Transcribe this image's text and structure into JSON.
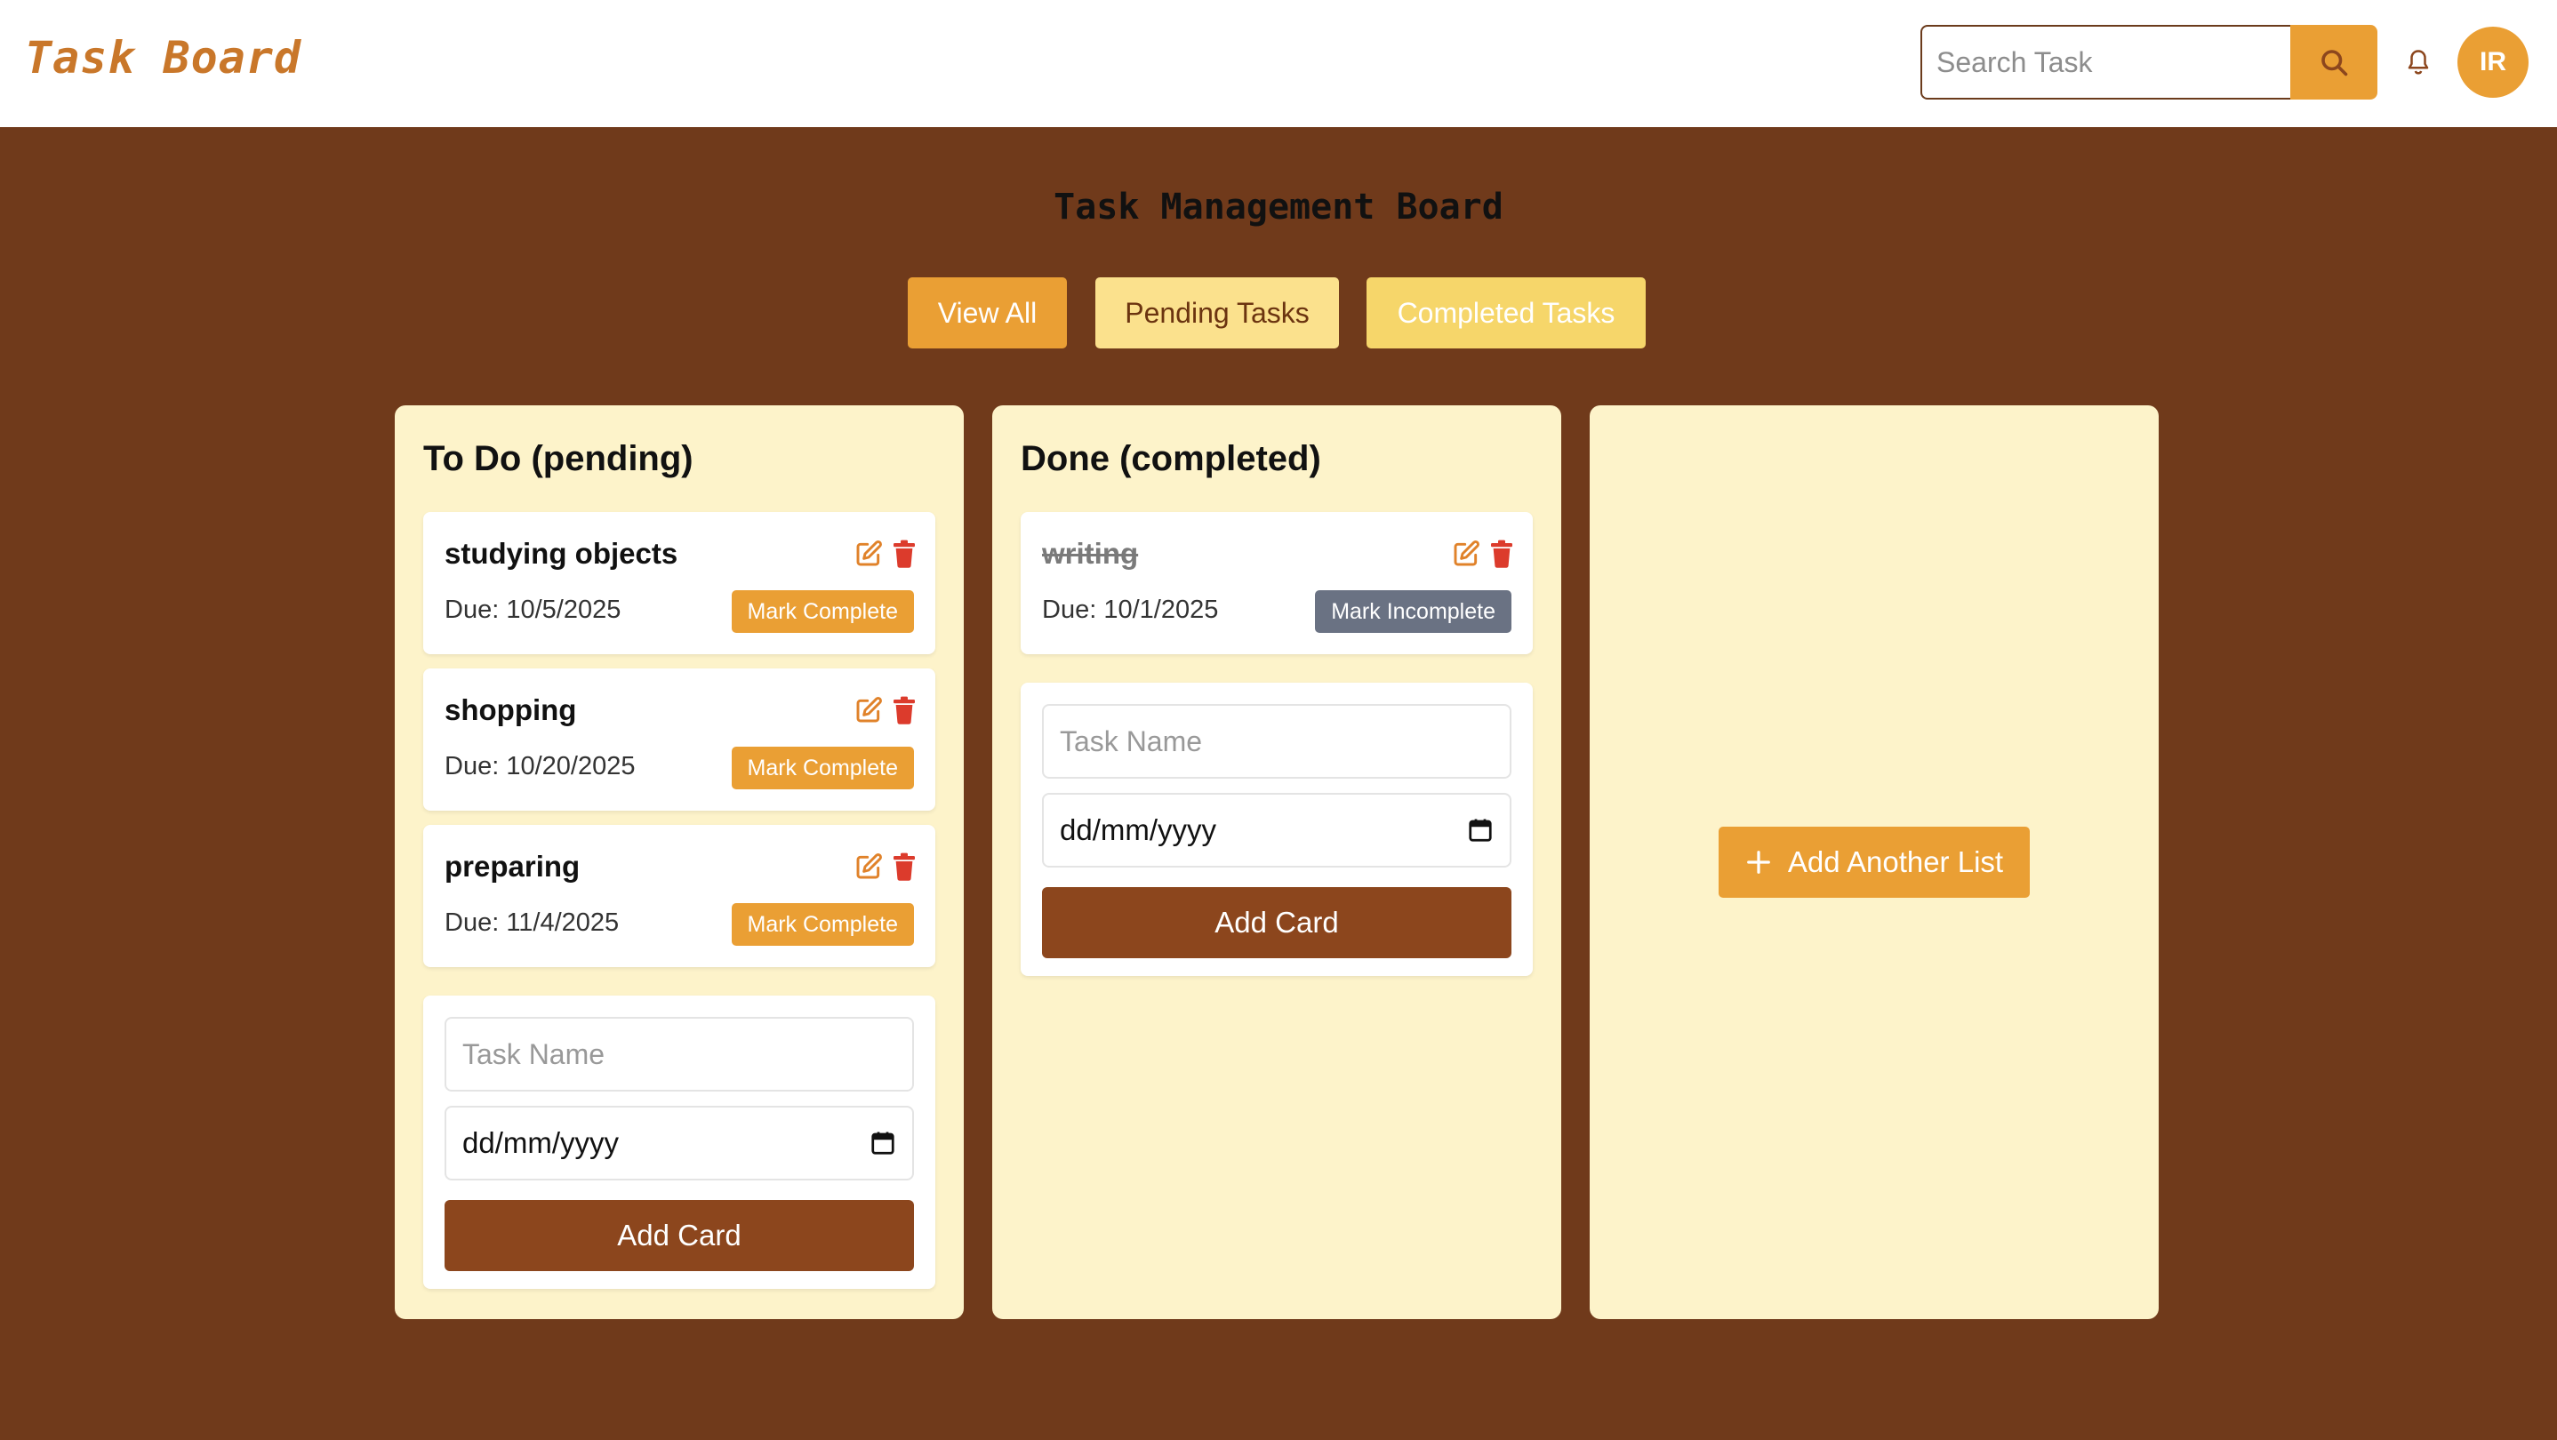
{
  "header": {
    "logo": "Task Board",
    "search_placeholder": "Search Task",
    "avatar_initials": "IR"
  },
  "board": {
    "title": "Task Management Board",
    "filters": {
      "view_all": "View All",
      "pending": "Pending Tasks",
      "completed": "Completed Tasks"
    }
  },
  "lists": [
    {
      "title": "To Do (pending)",
      "cards": [
        {
          "name": "studying objects",
          "due": "Due: 10/5/2025",
          "action": "Mark Complete"
        },
        {
          "name": "shopping",
          "due": "Due: 10/20/2025",
          "action": "Mark Complete"
        },
        {
          "name": "preparing",
          "due": "Due: 11/4/2025",
          "action": "Mark Complete"
        }
      ],
      "form": {
        "name_placeholder": "Task Name",
        "date_placeholder": "dd/mm/yyyy",
        "submit": "Add Card"
      }
    },
    {
      "title": "Done (completed)",
      "cards": [
        {
          "name": "writing",
          "due": "Due: 10/1/2025",
          "action": "Mark Incomplete"
        }
      ],
      "form": {
        "name_placeholder": "Task Name",
        "date_placeholder": "dd/mm/yyyy",
        "submit": "Add Card"
      }
    }
  ],
  "add_list": {
    "label": "Add Another List",
    "icon": "plus-icon"
  },
  "colors": {
    "accent": "#ea9f34",
    "background": "#703a1b",
    "column": "#fdf3ca",
    "add_card": "#8c461d",
    "delete": "#dc3b2c",
    "incomplete": "#6a7283"
  }
}
